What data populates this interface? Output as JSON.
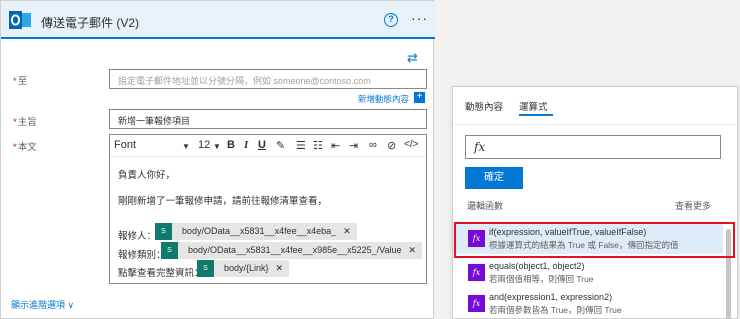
{
  "card": {
    "title": "傳送電子郵件 (V2)",
    "help": "?",
    "more": "···",
    "swap": "⇄",
    "to": {
      "label": "至",
      "placeholder": "指定電子郵件地址並以分號分隔，例如 someone@contoso.com"
    },
    "add_dynamic": "新增動態內容",
    "subject": {
      "label": "主旨",
      "value": "新增一筆報修項目"
    },
    "body": {
      "label": "本文",
      "toolbar": {
        "font": "Font",
        "size": "12"
      },
      "lines": [
        "負責人你好，",
        "剛剛新增了一筆報修申請，請前往報修清單查看，"
      ],
      "rows": [
        {
          "label": "報修人：",
          "token": "body/OData__x5831__x4fee__x4eba_"
        },
        {
          "label": "報修類別：",
          "token": "body/OData__x5831__x4fee__x985e__x5225_/Value"
        },
        {
          "label": "點擊查看完整資訊：",
          "token": "body/{Link}"
        }
      ],
      "token_icon": "S"
    },
    "advanced": "顯示進階選項 ∨"
  },
  "panel": {
    "tabs": [
      "動態內容",
      "運算式"
    ],
    "fx": "fx",
    "ok": "確定",
    "section_title": "邏輯函數",
    "see_more": "查看更多",
    "functions": [
      {
        "name": "if(expression, valueIfTrue, valueIfFalse)",
        "desc": "根據運算式的結果為 True 或 False，傳回指定的值"
      },
      {
        "name": "equals(object1, object2)",
        "desc": "若兩個值相等，則傳回 True"
      },
      {
        "name": "and(expression1, expression2)",
        "desc": "若兩個參數皆為 True，則傳回 True"
      }
    ]
  },
  "colors": {
    "accent": "#0078d4",
    "highlight": "#e81123",
    "function_icon": "#770bd6",
    "token_icon": "#0f7b6c"
  }
}
